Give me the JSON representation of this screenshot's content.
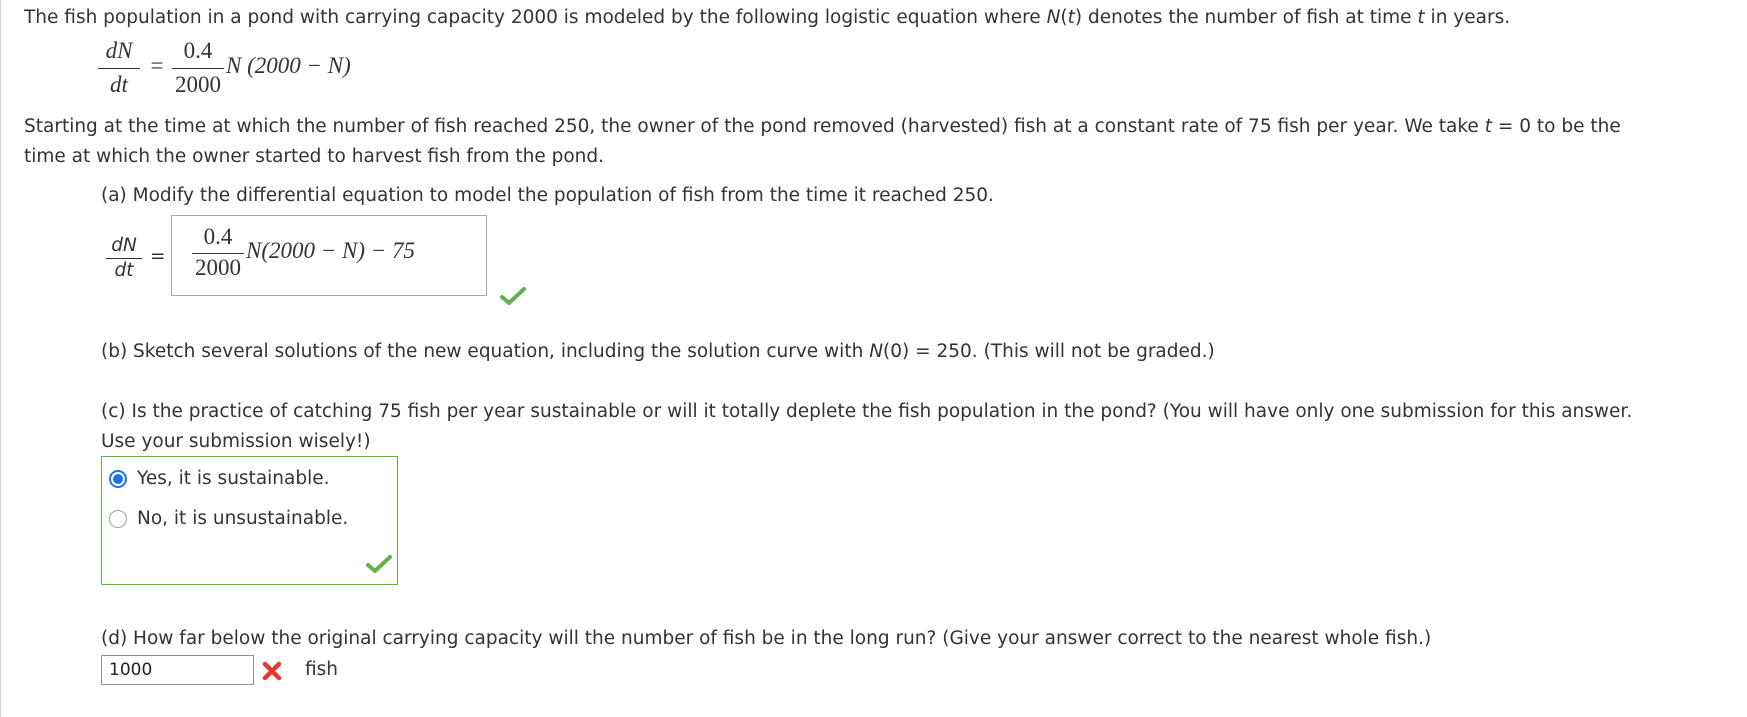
{
  "intro": {
    "text_before_N": "The fish population in a pond with carrying capacity 2000 is modeled by the following logistic equation where ",
    "N_symbol": "N",
    "paren_open": "(",
    "t_symbol": "t",
    "paren_close": ")",
    "text_middle": " denotes the number of fish at time ",
    "text_end": " in years."
  },
  "original_equation": {
    "lhs_num": "dN",
    "lhs_den": "dt",
    "equals": "=",
    "coef_num": "0.4",
    "coef_den": "2000",
    "rhs": "N (2000 − N)"
  },
  "harvest": {
    "line1_before_t": "Starting at the time at which the number of fish reached 250, the owner of the pond removed (harvested) fish at a constant rate of 75 fish per year. We take ",
    "t_symbol": "t",
    "line1_after_t": " = 0 to be the",
    "line2": "time at which the owner started to harvest fish from the pond."
  },
  "part_a": {
    "prompt": "(a) Modify the differential equation to model the population of fish from the time it reached 250.",
    "lhs_num": "dN",
    "lhs_den": "dt",
    "equals": "=",
    "answer_num": "0.4",
    "answer_den": "2000",
    "answer_rest": "N(2000 − N) − 75",
    "status_icon": "check-icon"
  },
  "part_b": {
    "before_N": "(b) Sketch several solutions of the new equation, including the solution curve with ",
    "N_symbol": "N",
    "after_N": "(0) = 250. (This will not be graded.)"
  },
  "part_c": {
    "line1": "(c) Is the practice of catching 75 fish per year sustainable or will it totally deplete the fish population in the pond? (You will have only one submission for this answer.",
    "line2": "Use your submission wisely!)",
    "options": [
      {
        "label": "Yes, it is sustainable.",
        "selected": true
      },
      {
        "label": "No, it is unsustainable.",
        "selected": false
      }
    ],
    "status_icon": "check-icon"
  },
  "part_d": {
    "prompt": "(d) How far below the original carrying capacity will the number of fish be in the long run? (Give your answer correct to the nearest whole fish.)",
    "answer_value": "1000",
    "status_icon": "x-icon",
    "unit": "fish"
  },
  "colors": {
    "correct": "#64b14b",
    "incorrect": "#e53935",
    "radio_selected": "#1a73e8",
    "text": "#333333"
  }
}
